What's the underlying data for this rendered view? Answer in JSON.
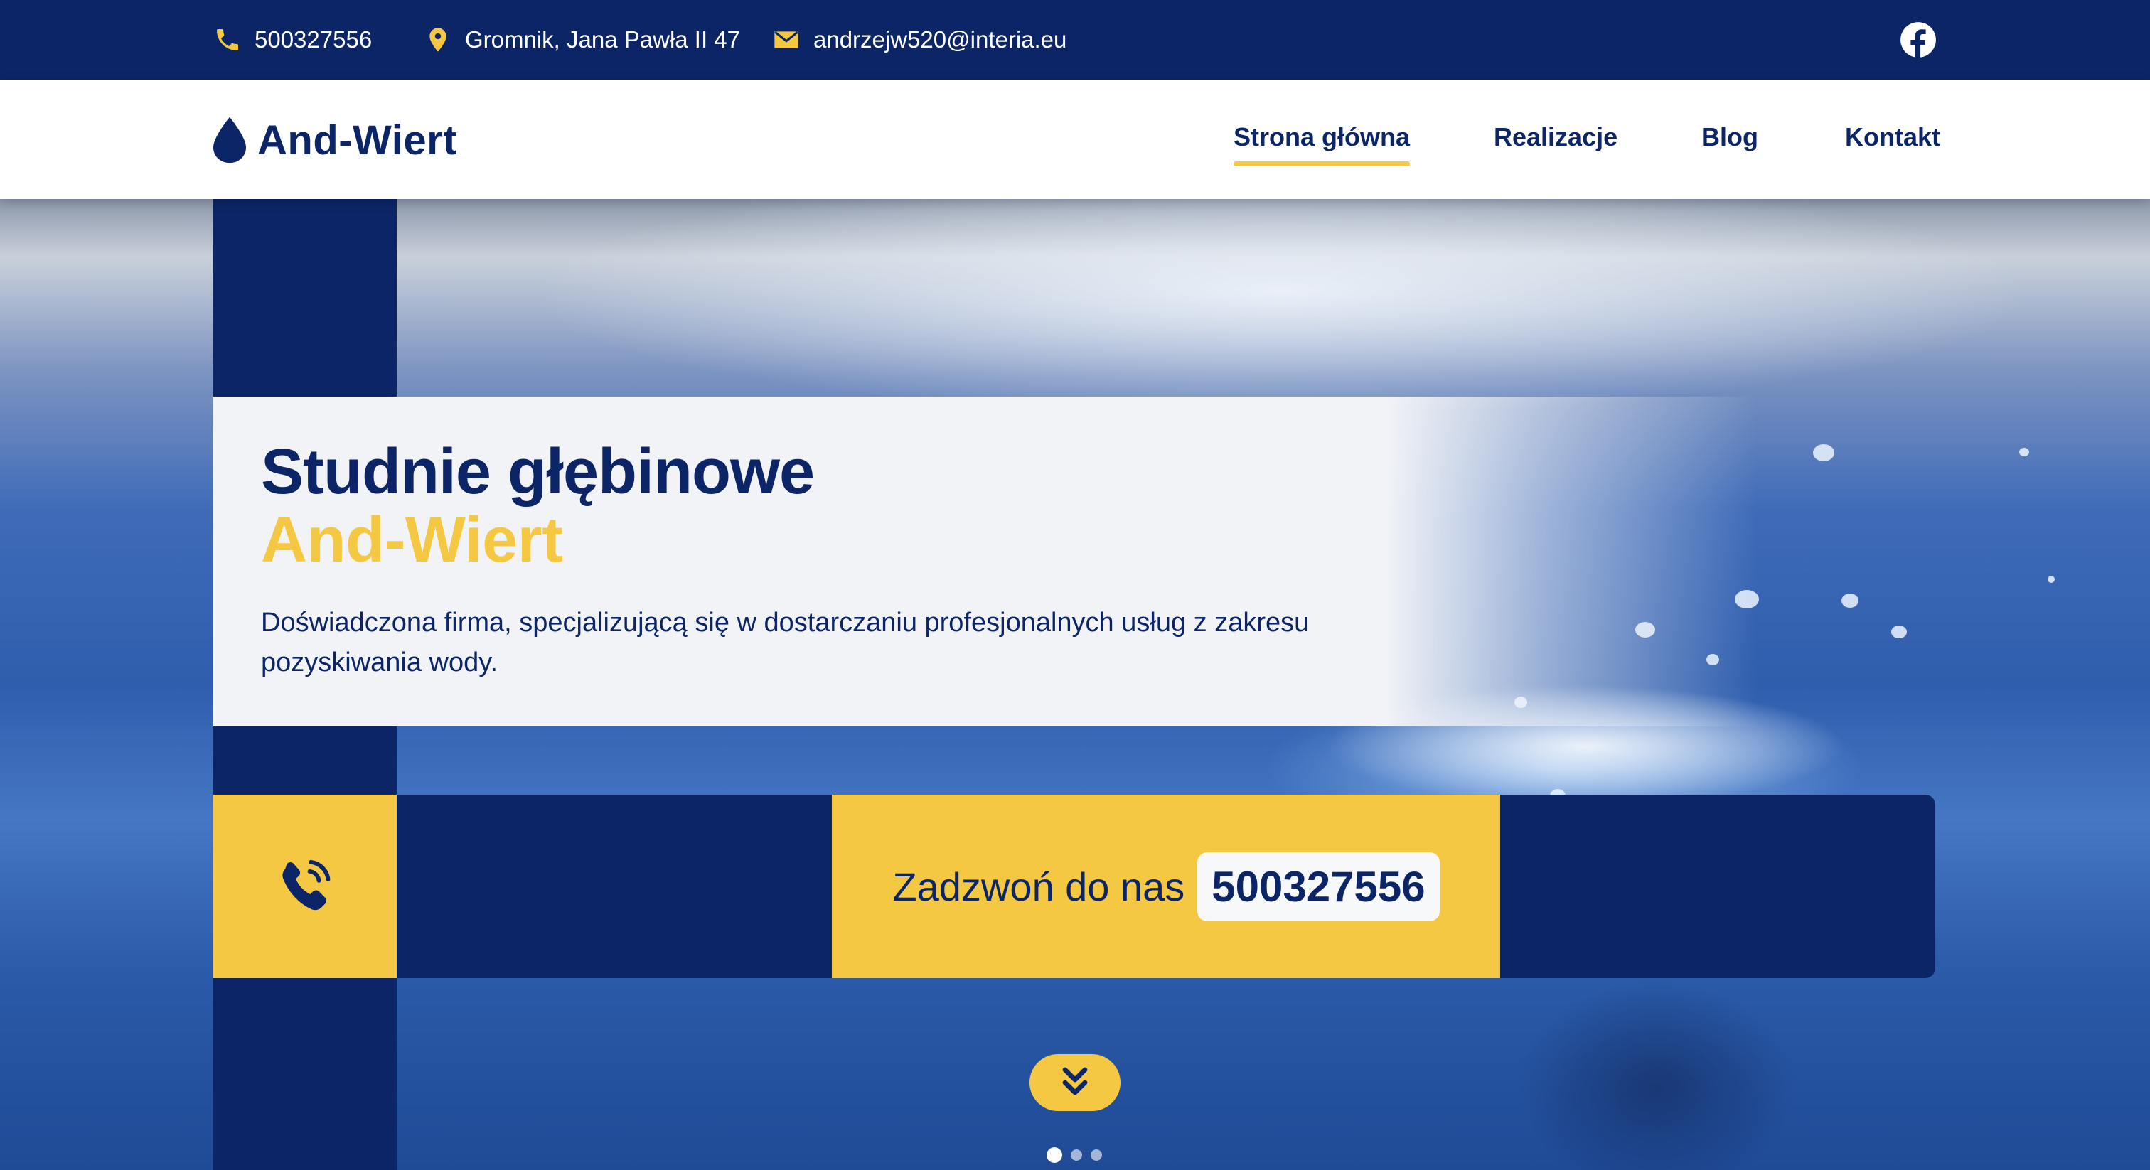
{
  "topbar": {
    "phone": "500327556",
    "address": "Gromnik, Jana Pawła II 47",
    "email": "andrzejw520@interia.eu",
    "icons": {
      "phone": "phone-icon",
      "address": "map-pin-icon",
      "email": "envelope-icon",
      "social": "facebook-icon"
    }
  },
  "nav": {
    "logo_text": "And-Wiert",
    "logo_icon": "water-drop-icon",
    "items": [
      {
        "label": "Strona główna",
        "active": true
      },
      {
        "label": "Realizacje",
        "active": false
      },
      {
        "label": "Blog",
        "active": false
      },
      {
        "label": "Kontakt",
        "active": false
      }
    ]
  },
  "hero": {
    "title": "Studnie głębinowe",
    "brand": "And-Wiert",
    "description": "Doświadczona firma, specjalizującą się w dostarczaniu profesjonalnych usług z zakresu pozyskiwania wody.",
    "call_label": "Zadzwoń do nas",
    "call_number": "500327556",
    "call_icon": "phone-ringing-icon",
    "scroll_icon": "double-chevron-down-icon",
    "slides": {
      "count": 3,
      "active": 1
    }
  },
  "colors": {
    "navy": "#0c2566",
    "yellow": "#f4c842",
    "panel": "#f1f3f7",
    "white": "#ffffff"
  }
}
